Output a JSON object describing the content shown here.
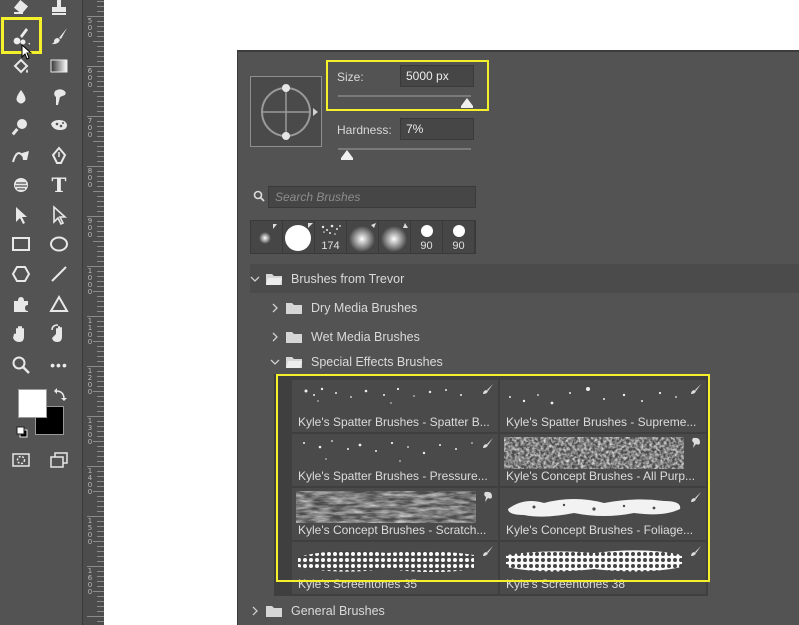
{
  "colors": {
    "ui_dark": "#535353",
    "highlight": "#f4f02c",
    "foreground_swatch": "#ffffff",
    "background_swatch": "#000000"
  },
  "toolbar": {
    "tools_left": [
      "eraser-icon",
      "mixer-brush-icon",
      "paint-bucket-icon",
      "blur-icon",
      "dodge-icon",
      "curvature-pen-icon",
      "3d-material-icon",
      "path-selection-icon",
      "rectangle-icon",
      "hexagon-icon",
      "puzzle-shape-icon",
      "hand-icon",
      "zoom-icon",
      "quick-mask-icon"
    ],
    "tools_right": [
      "stamp-icon",
      "brush-icon",
      "gradient-icon",
      "smudge-icon",
      "sponge-icon",
      "pen-icon",
      "type-icon",
      "direct-selection-icon",
      "ellipse-icon",
      "line-icon",
      "triangle-icon",
      "rotate-view-icon",
      "more-tools-icon",
      "screen-mode-icon"
    ],
    "type_glyph": "T",
    "more_glyph": "•••"
  },
  "ruler": {
    "labels": [
      "500",
      "600",
      "700",
      "800",
      "900",
      "1000",
      "1100",
      "1200",
      "1300",
      "1400",
      "1500",
      "1600"
    ]
  },
  "brush_panel": {
    "size": {
      "label": "Size:",
      "value": "5000 px",
      "level": 1.0
    },
    "hardness": {
      "label": "Hardness:",
      "value": "7%",
      "level": 0.07
    },
    "search": {
      "placeholder": "Search Brushes"
    },
    "recent_brushes": [
      "",
      "",
      "174",
      "",
      "",
      "90",
      "90"
    ],
    "tree": {
      "root": "Brushes from Trevor",
      "folders": [
        "Dry Media Brushes",
        "Wet Media Brushes",
        "Special Effects Brushes"
      ],
      "after": "General Brushes"
    },
    "brushes": [
      "Kyle's Spatter Brushes - Spatter B...",
      "Kyle's Spatter Brushes - Supreme...",
      "Kyle's Spatter Brushes - Pressure...",
      "Kyle's Concept Brushes - All Purp...",
      "Kyle's Concept Brushes - Scratch...",
      "Kyle's Concept Brushes - Foliage...",
      "Kyle's Screentones 35",
      "Kyle's Screentones 38"
    ]
  }
}
